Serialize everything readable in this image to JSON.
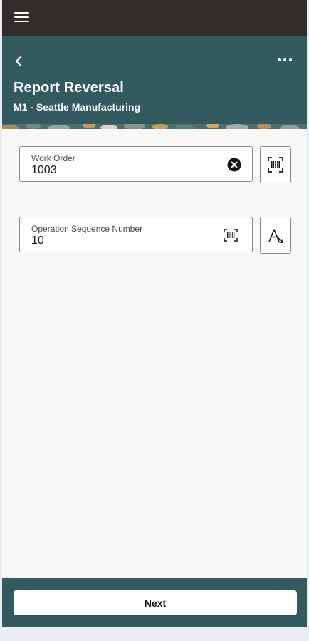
{
  "app_bar": {
    "menu_icon": "hamburger-menu-icon"
  },
  "header": {
    "back_icon": "chevron-left-icon",
    "more_icon": "more-horizontal-icon",
    "title": "Report Reversal",
    "subtitle": "M1 - Seattle Manufacturing"
  },
  "form": {
    "work_order": {
      "label": "Work Order",
      "value": "1003",
      "clear_icon": "clear-circle-icon",
      "scan_icon": "barcode-scan-icon"
    },
    "operation_sequence": {
      "label": "Operation Sequence Number",
      "value": "10",
      "scan_icon": "barcode-scan-icon",
      "side_icon": "text-input-mode-icon"
    }
  },
  "footer": {
    "next_label": "Next"
  },
  "colors": {
    "top_bar": "#312d2a",
    "header": "#325a5f",
    "footer": "#325a5f",
    "page_bg": "#f9f8f6"
  }
}
